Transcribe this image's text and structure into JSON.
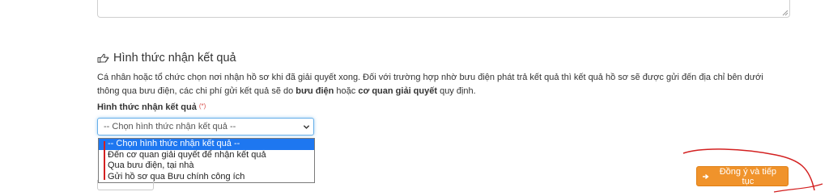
{
  "section": {
    "icon": "hand-pointing-right-icon",
    "title": "Hình thức nhận kết quả",
    "description_part1": "Cá nhân hoặc tổ chức chọn nơi nhận hồ sơ khi đã giải quyết xong. Đối với trường hợp nhờ bưu điện phát trả kết quả thì kết quả hồ sơ sẽ được gửi đến địa chỉ bên dưới thông qua bưu điện, các chi phí gửi kết quả sẽ do ",
    "description_bold1": "bưu điện",
    "description_part2": " hoặc ",
    "description_bold2": "cơ quan giải quyết",
    "description_part3": " quy định."
  },
  "field": {
    "label": "Hình thức nhận kết quả",
    "required_mark": "(*)",
    "selected_value": "-- Chọn hình thức nhận kết quả --",
    "options": [
      "-- Chọn hình thức nhận kết quả --",
      "Đến cơ quan giải quyết để nhận kết quả",
      "Qua bưu điện, tại nhà",
      "Gửi hồ sơ qua Bưu chính công ích"
    ],
    "highlighted_index": 0
  },
  "actions": {
    "continue_label": "Đồng ý và tiếp tục",
    "continue_icon": "arrow-circle-right-icon"
  },
  "colors": {
    "accent_button": "#f0932b",
    "dropdown_highlight": "#1e77f0",
    "annotation_red": "#d32020"
  }
}
